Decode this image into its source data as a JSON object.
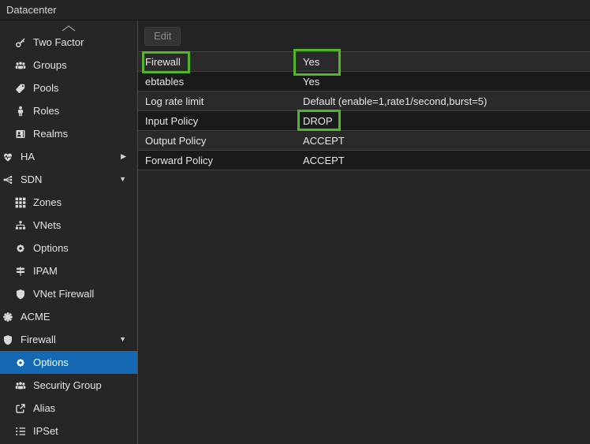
{
  "header": {
    "title": "Datacenter"
  },
  "toolbar": {
    "edit_label": "Edit"
  },
  "icons": {
    "expander_collapsed": "▶",
    "expander_expanded": "▼"
  },
  "sidebar": {
    "items": [
      {
        "label": "Two Factor",
        "icon": "key",
        "level": 2
      },
      {
        "label": "Groups",
        "icon": "users",
        "level": 2
      },
      {
        "label": "Pools",
        "icon": "tag",
        "level": 2
      },
      {
        "label": "Roles",
        "icon": "person",
        "level": 2
      },
      {
        "label": "Realms",
        "icon": "id-card",
        "level": 2
      },
      {
        "label": "HA",
        "icon": "heartbeat",
        "level": 1,
        "expander": "collapsed"
      },
      {
        "label": "SDN",
        "icon": "network-nodes",
        "level": 1,
        "expander": "expanded"
      },
      {
        "label": "Zones",
        "icon": "grid",
        "level": 2
      },
      {
        "label": "VNets",
        "icon": "sitemap",
        "level": 2
      },
      {
        "label": "Options",
        "icon": "gear",
        "level": 2
      },
      {
        "label": "IPAM",
        "icon": "map-signs",
        "level": 2
      },
      {
        "label": "VNet Firewall",
        "icon": "shield",
        "level": 2
      },
      {
        "label": "ACME",
        "icon": "certificate",
        "level": 1
      },
      {
        "label": "Firewall",
        "icon": "shield",
        "level": 1,
        "expander": "expanded"
      },
      {
        "label": "Options",
        "icon": "gear",
        "level": 2,
        "selected": true
      },
      {
        "label": "Security Group",
        "icon": "users",
        "level": 2
      },
      {
        "label": "Alias",
        "icon": "external-link",
        "level": 2
      },
      {
        "label": "IPSet",
        "icon": "list-ol",
        "level": 2
      }
    ]
  },
  "table": {
    "rows": [
      {
        "name": "Firewall",
        "value": "Yes"
      },
      {
        "name": "ebtables",
        "value": "Yes"
      },
      {
        "name": "Log rate limit",
        "value": "Default (enable=1,rate1/second,burst=5)"
      },
      {
        "name": "Input Policy",
        "value": "DROP"
      },
      {
        "name": "Output Policy",
        "value": "ACCEPT"
      },
      {
        "name": "Forward Policy",
        "value": "ACCEPT"
      }
    ]
  },
  "annotations": {
    "color": "#54b42c",
    "boxes": [
      {
        "target": "firewall-row-name"
      },
      {
        "target": "firewall-row-value"
      },
      {
        "target": "input-policy-value"
      }
    ]
  },
  "colors": {
    "selection_blue": "#1569b3",
    "row_light": "#2a2a2a",
    "row_dark": "#1a1a1a",
    "background": "#262626"
  }
}
